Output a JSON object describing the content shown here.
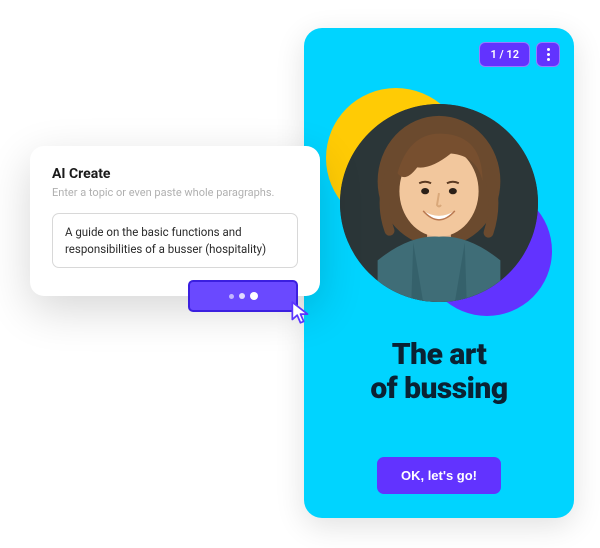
{
  "ai_panel": {
    "title": "AI Create",
    "subtitle": "Enter a topic or even paste whole paragraphs.",
    "input_value": "A guide on the basic functions and responsibilities of a busser (hospitality)"
  },
  "lesson": {
    "page_counter": "1 / 12",
    "title_line1": "The art",
    "title_line2": "of bussing",
    "cta_label": "OK, let's go!"
  },
  "colors": {
    "accent_purple": "#6233FF",
    "phone_bg": "#00D4FF",
    "blob_yellow": "#FFCB05"
  }
}
